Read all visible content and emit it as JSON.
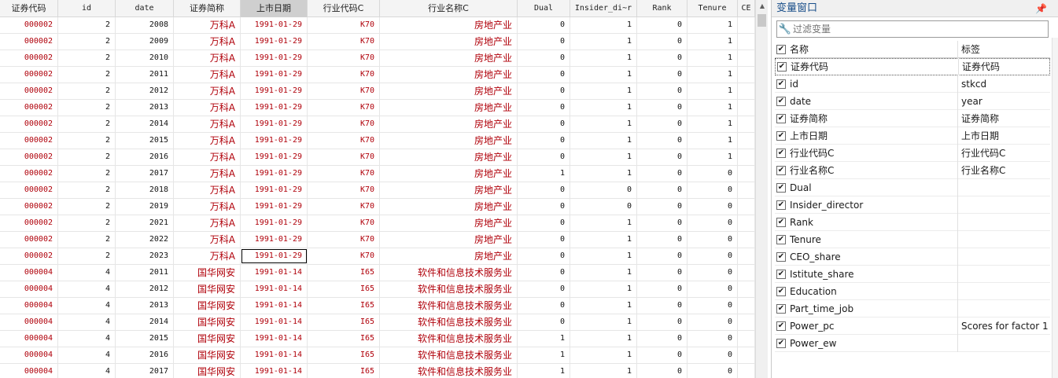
{
  "grid": {
    "columns": [
      {
        "label": "证券代码",
        "w": 74
      },
      {
        "label": "id",
        "w": 73
      },
      {
        "label": "date",
        "w": 74
      },
      {
        "label": "证券简称",
        "w": 85
      },
      {
        "label": "上市日期",
        "w": 85
      },
      {
        "label": "行业代码C",
        "w": 92
      },
      {
        "label": "行业名称C",
        "w": 175
      },
      {
        "label": "Dual",
        "w": 67
      },
      {
        "label": "Insider_di~r",
        "w": 85
      },
      {
        "label": "Rank",
        "w": 64
      },
      {
        "label": "Tenure",
        "w": 64
      },
      {
        "label": "CE",
        "w": 22
      }
    ],
    "rows": [
      [
        "000002",
        "2",
        "2008",
        "万科A",
        "1991-01-29",
        "K70",
        "房地产业",
        "0",
        "1",
        "0",
        "1"
      ],
      [
        "000002",
        "2",
        "2009",
        "万科A",
        "1991-01-29",
        "K70",
        "房地产业",
        "0",
        "1",
        "0",
        "1"
      ],
      [
        "000002",
        "2",
        "2010",
        "万科A",
        "1991-01-29",
        "K70",
        "房地产业",
        "0",
        "1",
        "0",
        "1"
      ],
      [
        "000002",
        "2",
        "2011",
        "万科A",
        "1991-01-29",
        "K70",
        "房地产业",
        "0",
        "1",
        "0",
        "1"
      ],
      [
        "000002",
        "2",
        "2012",
        "万科A",
        "1991-01-29",
        "K70",
        "房地产业",
        "0",
        "1",
        "0",
        "1"
      ],
      [
        "000002",
        "2",
        "2013",
        "万科A",
        "1991-01-29",
        "K70",
        "房地产业",
        "0",
        "1",
        "0",
        "1"
      ],
      [
        "000002",
        "2",
        "2014",
        "万科A",
        "1991-01-29",
        "K70",
        "房地产业",
        "0",
        "1",
        "0",
        "1"
      ],
      [
        "000002",
        "2",
        "2015",
        "万科A",
        "1991-01-29",
        "K70",
        "房地产业",
        "0",
        "1",
        "0",
        "1"
      ],
      [
        "000002",
        "2",
        "2016",
        "万科A",
        "1991-01-29",
        "K70",
        "房地产业",
        "0",
        "1",
        "0",
        "1"
      ],
      [
        "000002",
        "2",
        "2017",
        "万科A",
        "1991-01-29",
        "K70",
        "房地产业",
        "1",
        "1",
        "0",
        "0"
      ],
      [
        "000002",
        "2",
        "2018",
        "万科A",
        "1991-01-29",
        "K70",
        "房地产业",
        "0",
        "0",
        "0",
        "0"
      ],
      [
        "000002",
        "2",
        "2019",
        "万科A",
        "1991-01-29",
        "K70",
        "房地产业",
        "0",
        "0",
        "0",
        "0"
      ],
      [
        "000002",
        "2",
        "2021",
        "万科A",
        "1991-01-29",
        "K70",
        "房地产业",
        "0",
        "1",
        "0",
        "0"
      ],
      [
        "000002",
        "2",
        "2022",
        "万科A",
        "1991-01-29",
        "K70",
        "房地产业",
        "0",
        "1",
        "0",
        "0"
      ],
      [
        "000002",
        "2",
        "2023",
        "万科A",
        "1991-01-29",
        "K70",
        "房地产业",
        "0",
        "1",
        "0",
        "0"
      ],
      [
        "000004",
        "4",
        "2011",
        "国华网安",
        "1991-01-14",
        "I65",
        "软件和信息技术服务业",
        "0",
        "1",
        "0",
        "0"
      ],
      [
        "000004",
        "4",
        "2012",
        "国华网安",
        "1991-01-14",
        "I65",
        "软件和信息技术服务业",
        "0",
        "1",
        "0",
        "0"
      ],
      [
        "000004",
        "4",
        "2013",
        "国华网安",
        "1991-01-14",
        "I65",
        "软件和信息技术服务业",
        "0",
        "1",
        "0",
        "0"
      ],
      [
        "000004",
        "4",
        "2014",
        "国华网安",
        "1991-01-14",
        "I65",
        "软件和信息技术服务业",
        "0",
        "1",
        "0",
        "0"
      ],
      [
        "000004",
        "4",
        "2015",
        "国华网安",
        "1991-01-14",
        "I65",
        "软件和信息技术服务业",
        "1",
        "1",
        "0",
        "0"
      ],
      [
        "000004",
        "4",
        "2016",
        "国华网安",
        "1991-01-14",
        "I65",
        "软件和信息技术服务业",
        "1",
        "1",
        "0",
        "0"
      ],
      [
        "000004",
        "4",
        "2017",
        "国华网安",
        "1991-01-14",
        "I65",
        "软件和信息技术服务业",
        "1",
        "1",
        "0",
        "0"
      ]
    ]
  },
  "varpanel": {
    "title": "变量窗口",
    "pin_icon": "pin-icon",
    "filter_placeholder": "过滤变量",
    "header": {
      "name": "名称",
      "label": "标签"
    },
    "variables": [
      {
        "name": "证券代码",
        "label": "证券代码"
      },
      {
        "name": "id",
        "label": "stkcd"
      },
      {
        "name": "date",
        "label": "year"
      },
      {
        "name": "证券简称",
        "label": "证券简称"
      },
      {
        "name": "上市日期",
        "label": "上市日期"
      },
      {
        "name": "行业代码C",
        "label": "行业代码C"
      },
      {
        "name": "行业名称C",
        "label": "行业名称C"
      },
      {
        "name": "Dual",
        "label": ""
      },
      {
        "name": "Insider_director",
        "label": ""
      },
      {
        "name": "Rank",
        "label": ""
      },
      {
        "name": "Tenure",
        "label": ""
      },
      {
        "name": "CEO_share",
        "label": ""
      },
      {
        "name": "Istitute_share",
        "label": ""
      },
      {
        "name": "Education",
        "label": ""
      },
      {
        "name": "Part_time_job",
        "label": ""
      },
      {
        "name": "Power_pc",
        "label": "Scores for factor 1"
      },
      {
        "name": "Power_ew",
        "label": ""
      }
    ]
  },
  "colors": {
    "string_red": "#b0000a",
    "title_blue": "#1a4f8a"
  }
}
